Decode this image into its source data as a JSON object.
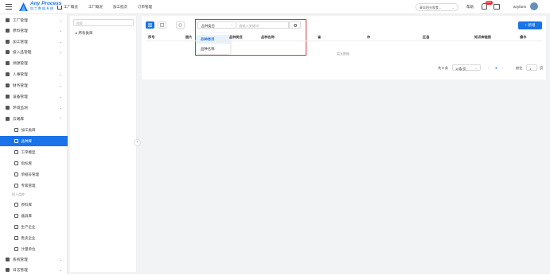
{
  "header": {
    "brand_title": "Any Process",
    "brand_subtitle": "加工数据系统",
    "nav": [
      "工厂概览",
      "工厂概况",
      "加工批次",
      "订单管理"
    ],
    "factory_select": "青岛阳光和食...",
    "help": "帮助",
    "badge": "99+",
    "username": "anyfarm"
  },
  "sidebar": {
    "items": [
      {
        "label": "工厂管理",
        "icon": "grid-icon"
      },
      {
        "label": "原料管理",
        "icon": "cross-icon"
      },
      {
        "label": "加工管理",
        "icon": "hammer-icon"
      },
      {
        "label": "投入品管理",
        "icon": "box-icon"
      },
      {
        "label": "溯源管理",
        "icon": "link-icon"
      },
      {
        "label": "人事管理",
        "icon": "person-icon"
      },
      {
        "label": "财务管理",
        "icon": "finance-icon"
      },
      {
        "label": "设备管理",
        "icon": "device-icon"
      },
      {
        "label": "环境监测",
        "icon": "monitor-icon"
      },
      {
        "label": "云端库",
        "icon": "cloud-icon"
      }
    ],
    "sub_items": [
      {
        "label": "加工类目",
        "icon": "category-icon"
      },
      {
        "label": "品种库",
        "icon": "library-icon"
      },
      {
        "label": "工序模型",
        "icon": "process-icon"
      },
      {
        "label": "指标库",
        "icon": "flag-icon"
      },
      {
        "label": "单据号管理",
        "icon": "doc-icon"
      },
      {
        "label": "专家管理",
        "icon": "expert-icon"
      }
    ],
    "group_label": "投入品库",
    "group_items": [
      {
        "label": "原料库",
        "icon": "raw-icon"
      },
      {
        "label": "器具库",
        "icon": "tool-icon"
      },
      {
        "label": "生产企业",
        "icon": "factory-icon"
      },
      {
        "label": "售卖企业",
        "icon": "shop-icon"
      },
      {
        "label": "计量单位",
        "icon": "measure-icon"
      }
    ],
    "bottom_items": [
      {
        "label": "系统管理",
        "icon": "system-icon"
      },
      {
        "label": "日志管理",
        "icon": "log-icon"
      }
    ]
  },
  "tree": {
    "search_placeholder": "搜索",
    "root_node": "所有类目"
  },
  "toolbar": {
    "category_select": "品种类目",
    "search_placeholder": "请输入关键词",
    "add_label": "+ 新增",
    "dropdown_options": [
      "品种类目",
      "品种名称"
    ]
  },
  "table": {
    "headers": [
      "序号",
      "图片",
      "品种类目",
      "品种名称",
      "省",
      "市",
      "区县",
      "知识库链接",
      "操作"
    ],
    "empty_text": "暂无数据"
  },
  "pagination": {
    "total": "共 0 条",
    "page_size": "10条/页",
    "current_page": "1",
    "goto_label": "前往",
    "goto_page": "1",
    "page_suffix": "页"
  }
}
